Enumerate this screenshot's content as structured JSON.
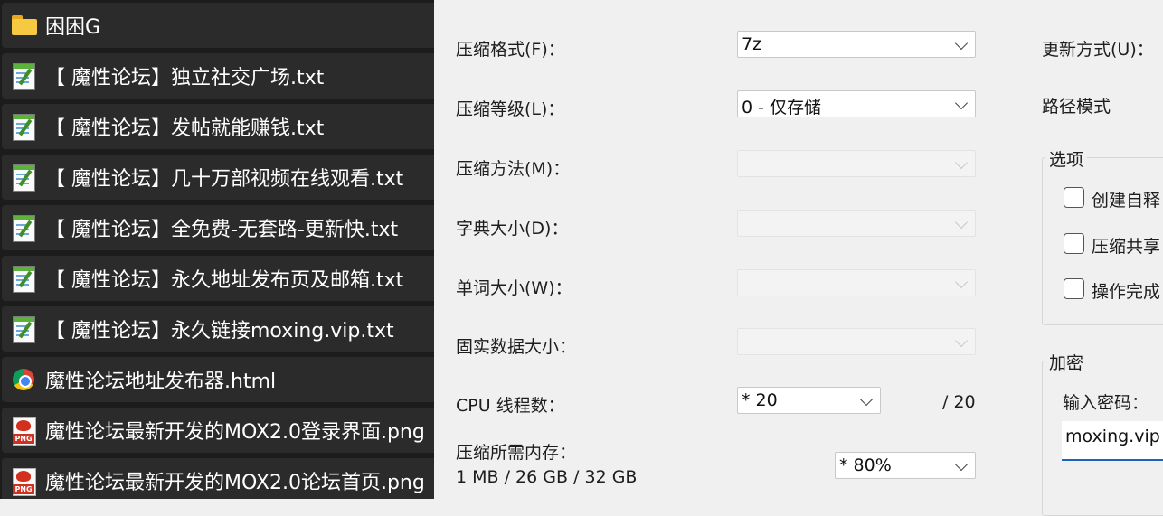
{
  "files": [
    {
      "name": "困困G",
      "type": "folder"
    },
    {
      "name": "【 魔性论坛】独立社交广场.txt",
      "type": "txt"
    },
    {
      "name": "【 魔性论坛】发帖就能赚钱.txt",
      "type": "txt"
    },
    {
      "name": "【 魔性论坛】几十万部视频在线观看.txt",
      "type": "txt"
    },
    {
      "name": "【 魔性论坛】全免费-无套路-更新快.txt",
      "type": "txt"
    },
    {
      "name": "【 魔性论坛】永久地址发布页及邮箱.txt",
      "type": "txt"
    },
    {
      "name": "【 魔性论坛】永久链接moxing.vip.txt",
      "type": "txt"
    },
    {
      "name": "魔性论坛地址发布器.html",
      "type": "html"
    },
    {
      "name": "魔性论坛最新开发的MOX2.0登录界面.png",
      "type": "png"
    },
    {
      "name": "魔性论坛最新开发的MOX2.0论坛首页.png",
      "type": "png"
    }
  ],
  "png_icon_label": "PNG",
  "dialog": {
    "format": {
      "label": "压缩格式(F)：",
      "value": "7z"
    },
    "level": {
      "label": "压缩等级(L)：",
      "value": "0 - 仅存储"
    },
    "method": {
      "label": "压缩方法(M)：",
      "value": ""
    },
    "dict": {
      "label": "字典大小(D)：",
      "value": ""
    },
    "word": {
      "label": "单词大小(W)：",
      "value": ""
    },
    "solid": {
      "label": "固实数据大小：",
      "value": ""
    },
    "threads": {
      "label": "CPU 线程数：",
      "value": "*  20",
      "total": "/ 20"
    },
    "memory": {
      "label": "压缩所需内存：",
      "usage": "1 MB / 26 GB / 32 GB",
      "value": "*  80%"
    },
    "update_mode": {
      "label": "更新方式(U)："
    },
    "path_mode": {
      "label": "路径模式"
    },
    "options": {
      "title": "选项",
      "items": [
        "创建自释",
        "压缩共享",
        "操作完成"
      ]
    },
    "encryption": {
      "title": "加密",
      "password_label": "输入密码：",
      "password_value": "moxing.vip"
    }
  },
  "colors": {
    "list_background": "#1c1c1c",
    "row_background": "#2b2b2b",
    "dialog_background": "#f0f0f0",
    "focus_underline": "#1d63b8"
  }
}
